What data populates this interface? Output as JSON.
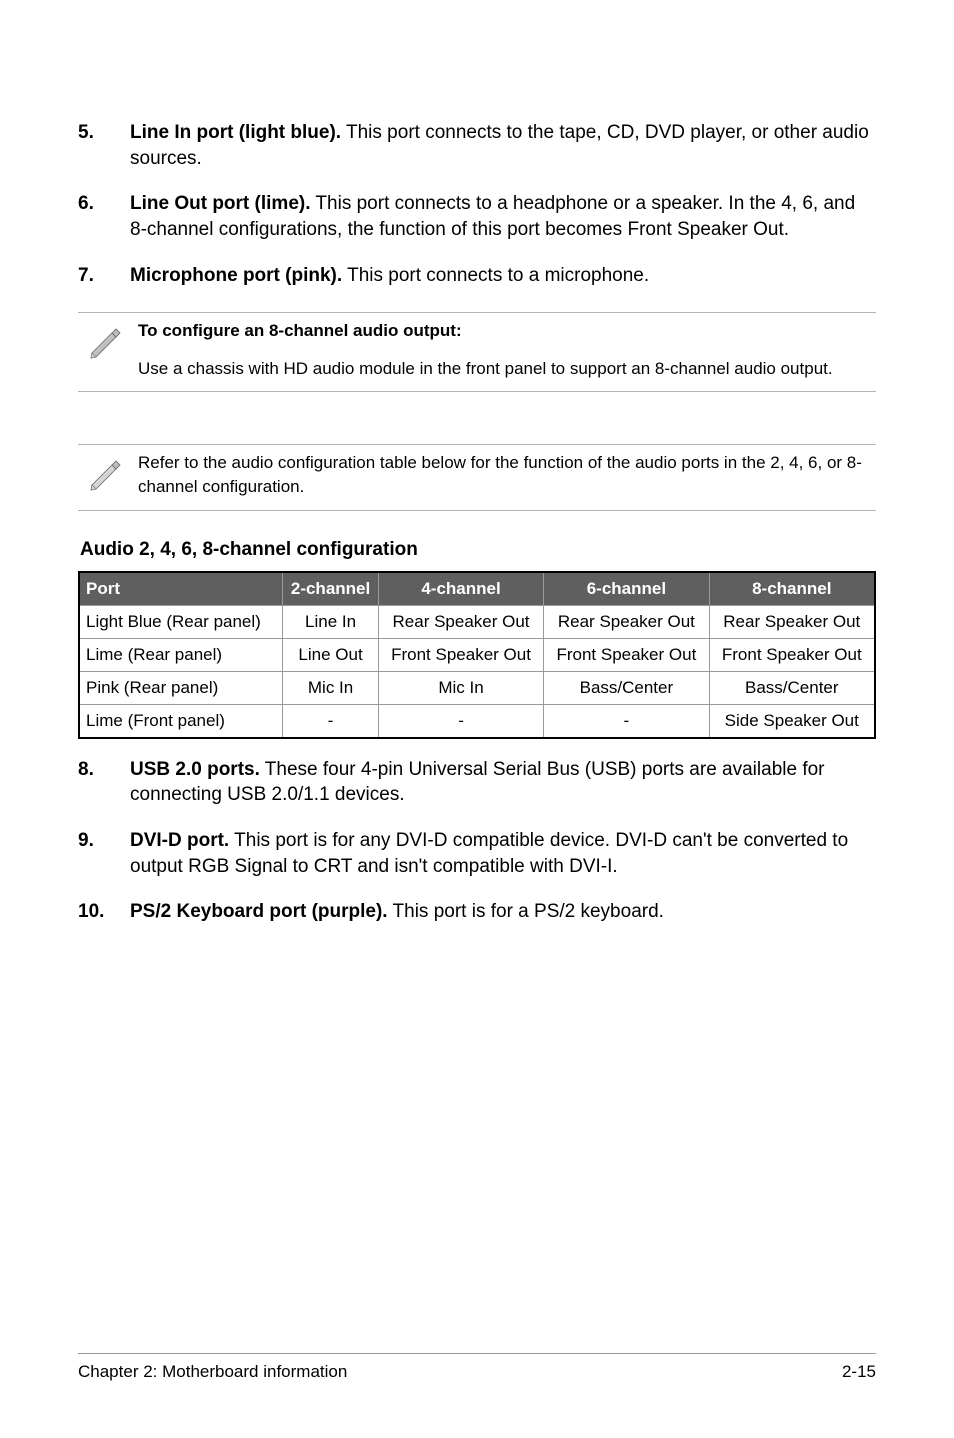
{
  "items_top": [
    {
      "num": "5.",
      "lead": "Line In port (light blue).",
      "text": " This port connects to the tape, CD, DVD player, or other audio sources."
    },
    {
      "num": "6.",
      "lead": "Line Out port (lime).",
      "text": " This port connects to a headphone or a speaker. In the 4, 6, and 8-channel configurations, the function of this port becomes Front Speaker Out."
    },
    {
      "num": "7.",
      "lead": "Microphone port (pink).",
      "text": " This port connects to a microphone."
    }
  ],
  "note1": {
    "heading": "To configure an 8-channel audio output:",
    "body": "Use a chassis with HD audio module in the front panel to support an 8-channel audio output."
  },
  "note2": {
    "body": "Refer to the audio configuration table below for the function of the audio ports in the 2, 4, 6, or 8-channel configuration."
  },
  "table_heading": "Audio 2, 4, 6, 8-channel configuration",
  "table": {
    "headers": [
      "Port",
      "2-channel",
      "4-channel",
      "6-channel",
      "8-channel"
    ],
    "rows": [
      [
        "Light Blue (Rear panel)",
        "Line In",
        "Rear Speaker Out",
        "Rear Speaker Out",
        "Rear Speaker Out"
      ],
      [
        "Lime (Rear panel)",
        "Line Out",
        "Front Speaker Out",
        "Front Speaker Out",
        "Front Speaker Out"
      ],
      [
        "Pink (Rear panel)",
        "Mic In",
        "Mic In",
        "Bass/Center",
        "Bass/Center"
      ],
      [
        "Lime (Front panel)",
        "-",
        "-",
        "-",
        "Side Speaker Out"
      ]
    ]
  },
  "items_bottom": [
    {
      "num": "8.",
      "lead": "USB 2.0 ports.",
      "text": " These four 4-pin Universal Serial Bus (USB) ports are available for connecting USB 2.0/1.1 devices."
    },
    {
      "num": "9.",
      "lead": "DVI-D port.",
      "text": " This port is for any DVI-D compatible device. DVI-D can't be converted to output RGB Signal to CRT and isn't compatible with DVI-I."
    },
    {
      "num": "10.",
      "lead": "PS/2 Keyboard port (purple).",
      "text": " This port is for a PS/2 keyboard."
    }
  ],
  "footer": {
    "left": "Chapter 2: Motherboard information",
    "right": "2-15"
  }
}
